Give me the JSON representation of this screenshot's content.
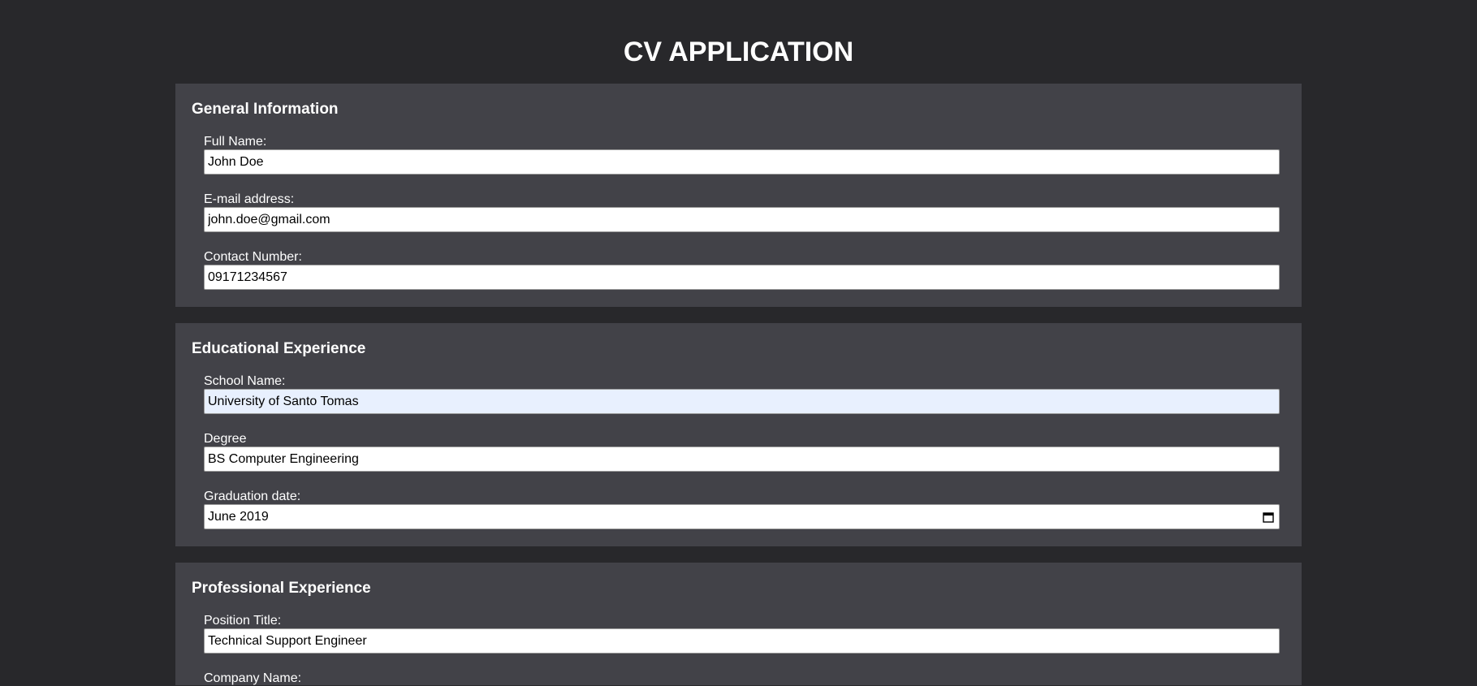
{
  "page": {
    "title": "CV APPLICATION"
  },
  "general": {
    "title": "General Information",
    "full_name_label": "Full Name:",
    "full_name_value": "John Doe",
    "email_label": "E-mail address:",
    "email_value": "john.doe@gmail.com",
    "contact_label": "Contact Number:",
    "contact_value": "09171234567"
  },
  "education": {
    "title": "Educational Experience",
    "school_label": "School Name:",
    "school_value": "University of Santo Tomas",
    "degree_label": "Degree",
    "degree_value": "BS Computer Engineering",
    "grad_label": "Graduation date:",
    "grad_value": "June 2019",
    "grad_icon": "calendar-icon"
  },
  "professional": {
    "title": "Professional Experience",
    "position_label": "Position Title:",
    "position_value": "Technical Support Engineer",
    "company_label": "Company Name:"
  },
  "colors": {
    "background": "#28282b",
    "panel": "#424248",
    "autofill": "#e8f0fe"
  }
}
